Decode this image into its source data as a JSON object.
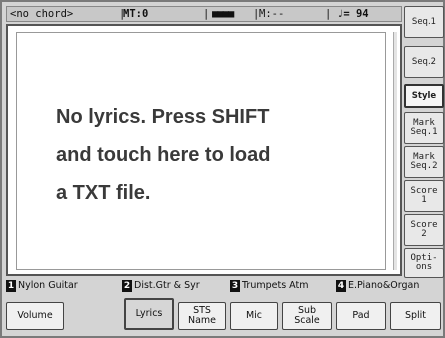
{
  "status_bar": {
    "chord": "<no chord>",
    "meter": "MT:0",
    "blocks": "■■■■",
    "measure": "M:--",
    "tempo": "♩= 94",
    "sep": "|"
  },
  "lyrics": {
    "line1": "No lyrics. Press SHIFT",
    "line2": "and touch here to load",
    "line3": "a TXT file."
  },
  "side_buttons": [
    {
      "label": "Seq.1"
    },
    {
      "label": "Seq.2"
    },
    {
      "label": "Style"
    },
    {
      "label": "Mark\nSeq.1"
    },
    {
      "label": "Mark\nSeq.2"
    },
    {
      "label": "Score\n1"
    },
    {
      "label": "Score\n2"
    },
    {
      "label": "Opti-\nons"
    }
  ],
  "tracks": [
    {
      "num": "1",
      "name": "Nylon Guitar"
    },
    {
      "num": "2",
      "name": "Dist.Gtr & Syr"
    },
    {
      "num": "3",
      "name": "Trumpets Atm"
    },
    {
      "num": "4",
      "name": "E.Piano&Organ"
    }
  ],
  "tabs": [
    {
      "label": "Volume"
    },
    {
      "label": "Lyrics"
    },
    {
      "label": "STS\nName"
    },
    {
      "label": "Mic"
    },
    {
      "label": "Sub\nScale"
    },
    {
      "label": "Pad"
    },
    {
      "label": "Split"
    }
  ],
  "colors": {
    "frame": "#d4d4d4",
    "display_bg": "#ffffff",
    "lyrics_text": "#3a3a3a",
    "track_number_bg": "#111111"
  }
}
